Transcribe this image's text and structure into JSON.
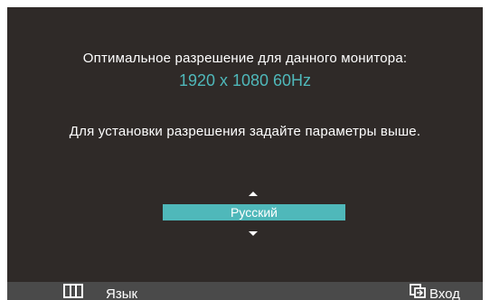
{
  "osd": {
    "optimal_text": "Оптимальное разрешение для данного монитора:",
    "resolution": "1920 x 1080  60Hz",
    "hint_text": "Для установки разрешения задайте параметры выше.",
    "language_value": "Русский"
  },
  "bottom_bar": {
    "menu_label": "Язык",
    "menu_icon": "menu-icon",
    "enter_label": "Вход",
    "enter_icon": "enter-icon"
  },
  "colors": {
    "background": "#2f2a28",
    "accent": "#4fb8ba",
    "bottom_bar": "#4a4a4a"
  }
}
